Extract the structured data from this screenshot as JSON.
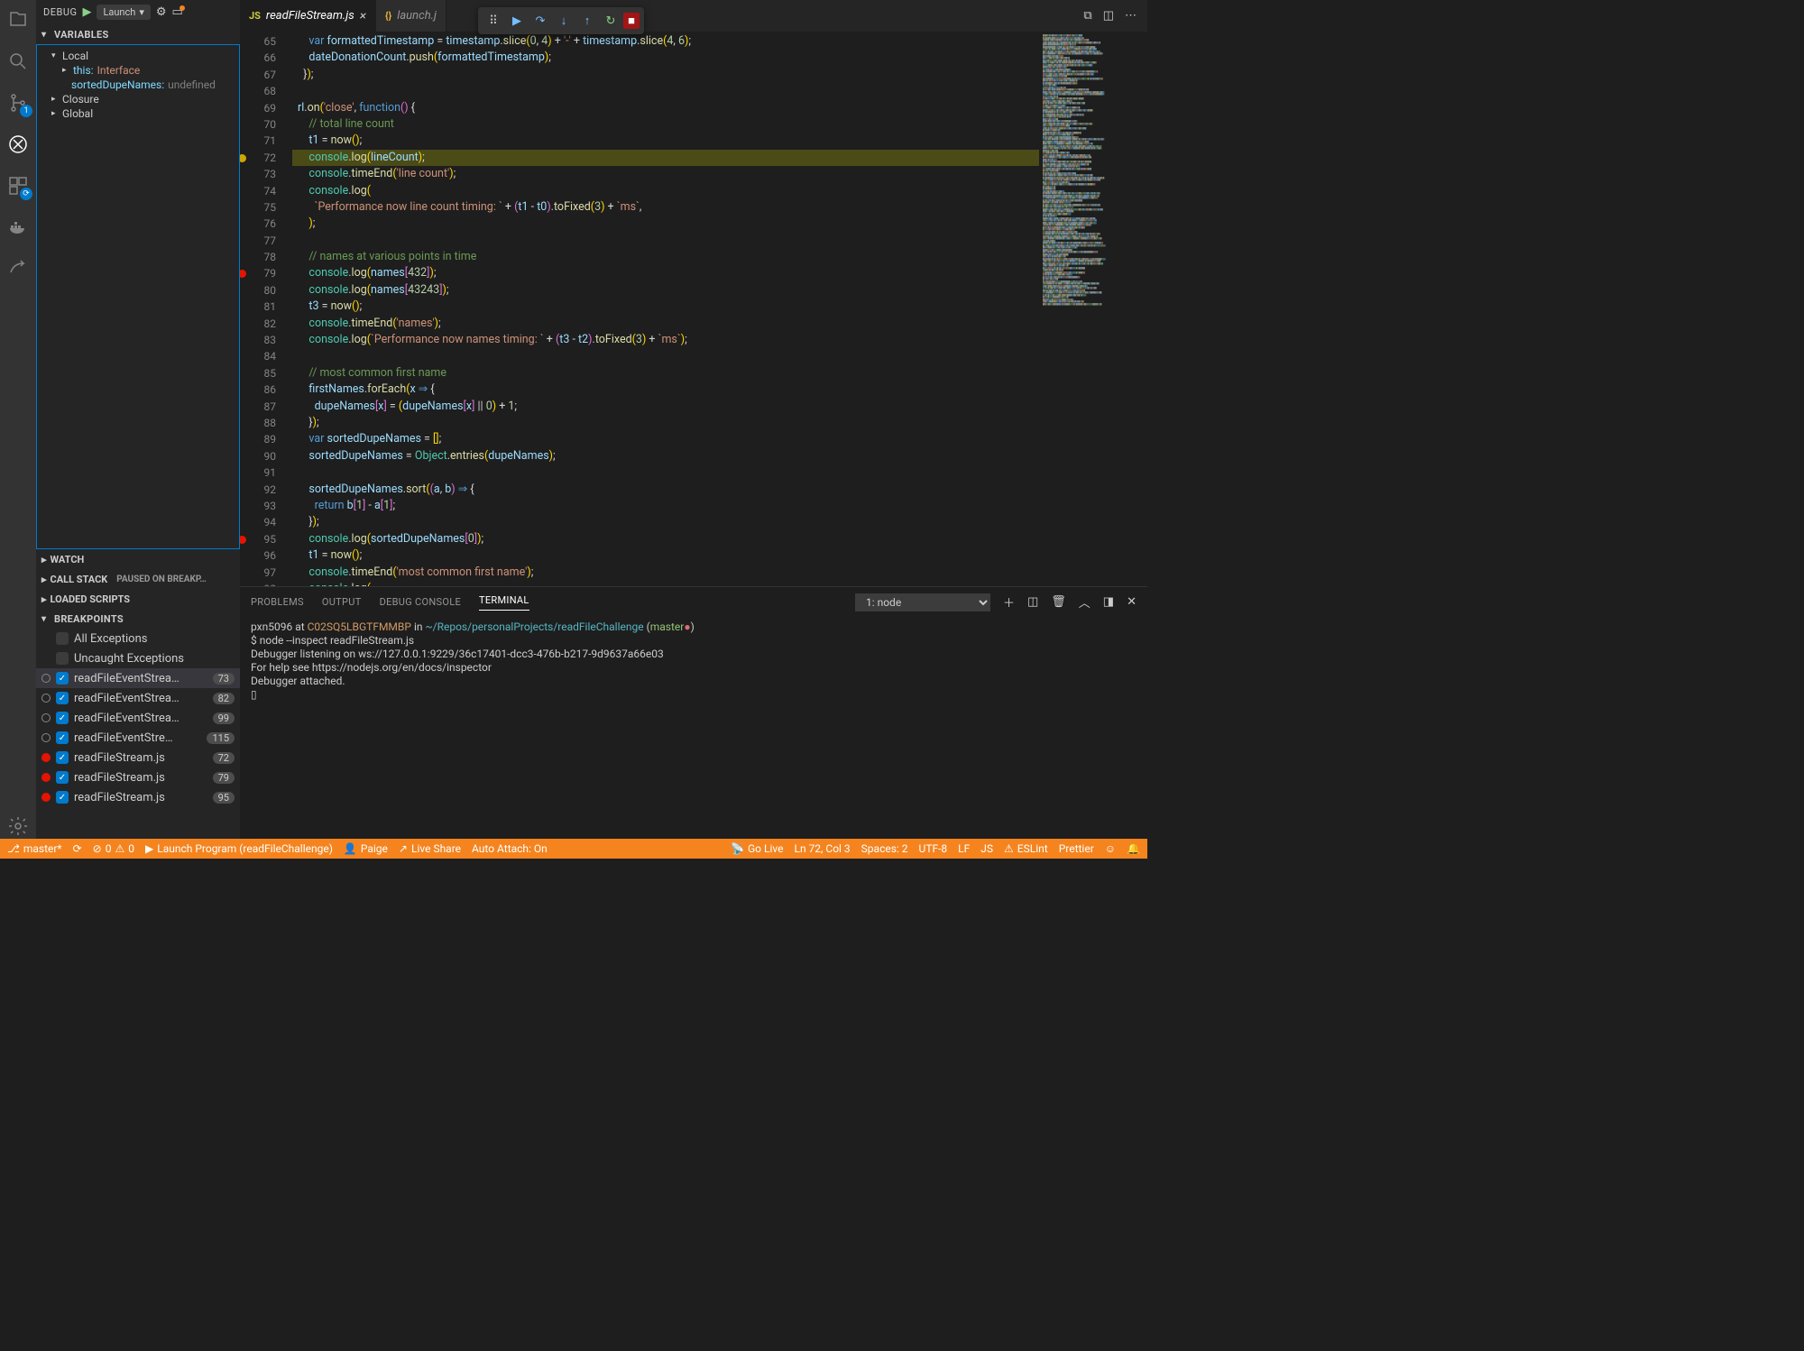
{
  "debugHeader": {
    "label": "DEBUG",
    "launchConfig": "Launch"
  },
  "tabs": [
    {
      "name": "readFileStream.js",
      "active": true,
      "icon": "JS"
    },
    {
      "name": "launch.j",
      "active": false,
      "icon": "{}"
    }
  ],
  "sidebar": {
    "variables": {
      "title": "VARIABLES",
      "scopes": [
        {
          "name": "Local",
          "expanded": true,
          "items": [
            {
              "kind": "ref",
              "label": "this:",
              "value": "Interface"
            },
            {
              "kind": "var",
              "label": "sortedDupeNames:",
              "value": "undefined"
            }
          ]
        },
        {
          "name": "Closure",
          "expanded": false
        },
        {
          "name": "Global",
          "expanded": false
        }
      ]
    },
    "watch": {
      "title": "WATCH"
    },
    "callStack": {
      "title": "CALL STACK",
      "status": "PAUSED ON BREAKP…"
    },
    "loadedScripts": {
      "title": "LOADED SCRIPTS"
    },
    "breakpoints": {
      "title": "BREAKPOINTS",
      "items": [
        {
          "type": "exc",
          "checked": false,
          "label": "All Exceptions"
        },
        {
          "type": "exc",
          "checked": false,
          "label": "Uncaught Exceptions"
        },
        {
          "type": "bp",
          "dot": "hollow",
          "checked": true,
          "label": "readFileEventStrea…",
          "line": "73",
          "sel": true
        },
        {
          "type": "bp",
          "dot": "hollow",
          "checked": true,
          "label": "readFileEventStrea…",
          "line": "82"
        },
        {
          "type": "bp",
          "dot": "hollow",
          "checked": true,
          "label": "readFileEventStrea…",
          "line": "99"
        },
        {
          "type": "bp",
          "dot": "hollow",
          "checked": true,
          "label": "readFileEventStre…",
          "line": "115"
        },
        {
          "type": "bp",
          "dot": "solid",
          "checked": true,
          "label": "readFileStream.js",
          "line": "72"
        },
        {
          "type": "bp",
          "dot": "solid",
          "checked": true,
          "label": "readFileStream.js",
          "line": "79"
        },
        {
          "type": "bp",
          "dot": "solid",
          "checked": true,
          "label": "readFileStream.js",
          "line": "95"
        }
      ]
    }
  },
  "code": {
    "startLine": 65,
    "currentLine": 72,
    "breakpoints": {
      "79": "red",
      "95": "red",
      "72": "yellow"
    },
    "lines": [
      [
        [
          "    ",
          ""
        ],
        [
          "var ",
          "kw"
        ],
        [
          "formattedTimestamp",
          "var"
        ],
        [
          " = ",
          "op"
        ],
        [
          "timestamp",
          "var"
        ],
        [
          ".",
          "op"
        ],
        [
          "slice",
          "fn"
        ],
        [
          "(",
          "par"
        ],
        [
          "0",
          "num"
        ],
        [
          ", ",
          "op"
        ],
        [
          "4",
          "num"
        ],
        [
          ")",
          "par"
        ],
        [
          " + ",
          "op"
        ],
        [
          "'-'",
          "str"
        ],
        [
          " + ",
          "op"
        ],
        [
          "timestamp",
          "var"
        ],
        [
          ".",
          "op"
        ],
        [
          "slice",
          "fn"
        ],
        [
          "(",
          "par"
        ],
        [
          "4",
          "num"
        ],
        [
          ", ",
          "op"
        ],
        [
          "6",
          "num"
        ],
        [
          ")",
          "par"
        ],
        [
          ";",
          "op"
        ]
      ],
      [
        [
          "    ",
          ""
        ],
        [
          "dateDonationCount",
          "var"
        ],
        [
          ".",
          "op"
        ],
        [
          "push",
          "fn"
        ],
        [
          "(",
          "par"
        ],
        [
          "formattedTimestamp",
          "var"
        ],
        [
          ")",
          "par"
        ],
        [
          ";",
          "op"
        ]
      ],
      [
        [
          "  }",
          "pun"
        ],
        [
          ")",
          "par"
        ],
        [
          ";",
          "op"
        ]
      ],
      [
        [
          "",
          ""
        ]
      ],
      [
        [
          "rl",
          "var"
        ],
        [
          ".",
          "op"
        ],
        [
          "on",
          "fn"
        ],
        [
          "(",
          "par"
        ],
        [
          "'close'",
          "str"
        ],
        [
          ", ",
          "op"
        ],
        [
          "function",
          "kw"
        ],
        [
          "()",
          "par2"
        ],
        [
          " {",
          "pun"
        ]
      ],
      [
        [
          "    ",
          ""
        ],
        [
          "// total line count",
          "cmt"
        ]
      ],
      [
        [
          "    ",
          ""
        ],
        [
          "t1",
          "var"
        ],
        [
          " = ",
          "op"
        ],
        [
          "now",
          "fn"
        ],
        [
          "()",
          "par"
        ],
        [
          ";",
          "op"
        ]
      ],
      [
        [
          "    ",
          ""
        ],
        [
          "console",
          "obj"
        ],
        [
          ".",
          "op"
        ],
        [
          "log",
          "fn"
        ],
        [
          "(",
          "par"
        ],
        [
          "lineCount",
          "var"
        ],
        [
          ")",
          "par"
        ],
        [
          ";",
          "op"
        ]
      ],
      [
        [
          "    ",
          ""
        ],
        [
          "console",
          "obj"
        ],
        [
          ".",
          "op"
        ],
        [
          "timeEnd",
          "fn"
        ],
        [
          "(",
          "par"
        ],
        [
          "'line count'",
          "str"
        ],
        [
          ")",
          "par"
        ],
        [
          ";",
          "op"
        ]
      ],
      [
        [
          "    ",
          ""
        ],
        [
          "console",
          "obj"
        ],
        [
          ".",
          "op"
        ],
        [
          "log",
          "fn"
        ],
        [
          "(",
          "par"
        ]
      ],
      [
        [
          "      ",
          ""
        ],
        [
          "`Performance now line count timing: `",
          "str"
        ],
        [
          " + ",
          "op"
        ],
        [
          "(",
          "par2"
        ],
        [
          "t1",
          "var"
        ],
        [
          " - ",
          "op"
        ],
        [
          "t0",
          "var"
        ],
        [
          ")",
          "par2"
        ],
        [
          ".",
          "op"
        ],
        [
          "toFixed",
          "fn"
        ],
        [
          "(",
          "par"
        ],
        [
          "3",
          "num"
        ],
        [
          ")",
          "par"
        ],
        [
          " + ",
          "op"
        ],
        [
          "`ms`",
          "str"
        ],
        [
          ",",
          "op"
        ]
      ],
      [
        [
          "    ",
          ""
        ],
        [
          ")",
          "par"
        ],
        [
          ";",
          "op"
        ]
      ],
      [
        [
          "",
          ""
        ]
      ],
      [
        [
          "    ",
          ""
        ],
        [
          "// names at various points in time",
          "cmt"
        ]
      ],
      [
        [
          "    ",
          ""
        ],
        [
          "console",
          "obj"
        ],
        [
          ".",
          "op"
        ],
        [
          "log",
          "fn"
        ],
        [
          "(",
          "par"
        ],
        [
          "names",
          "var"
        ],
        [
          "[",
          "par2"
        ],
        [
          "432",
          "num"
        ],
        [
          "]",
          "par2"
        ],
        [
          ")",
          "par"
        ],
        [
          ";",
          "op"
        ]
      ],
      [
        [
          "    ",
          ""
        ],
        [
          "console",
          "obj"
        ],
        [
          ".",
          "op"
        ],
        [
          "log",
          "fn"
        ],
        [
          "(",
          "par"
        ],
        [
          "names",
          "var"
        ],
        [
          "[",
          "par2"
        ],
        [
          "43243",
          "num"
        ],
        [
          "]",
          "par2"
        ],
        [
          ")",
          "par"
        ],
        [
          ";",
          "op"
        ]
      ],
      [
        [
          "    ",
          ""
        ],
        [
          "t3",
          "var"
        ],
        [
          " = ",
          "op"
        ],
        [
          "now",
          "fn"
        ],
        [
          "()",
          "par"
        ],
        [
          ";",
          "op"
        ]
      ],
      [
        [
          "    ",
          ""
        ],
        [
          "console",
          "obj"
        ],
        [
          ".",
          "op"
        ],
        [
          "timeEnd",
          "fn"
        ],
        [
          "(",
          "par"
        ],
        [
          "'names'",
          "str"
        ],
        [
          ")",
          "par"
        ],
        [
          ";",
          "op"
        ]
      ],
      [
        [
          "    ",
          ""
        ],
        [
          "console",
          "obj"
        ],
        [
          ".",
          "op"
        ],
        [
          "log",
          "fn"
        ],
        [
          "(",
          "par"
        ],
        [
          "`Performance now names timing: `",
          "str"
        ],
        [
          " + ",
          "op"
        ],
        [
          "(",
          "par2"
        ],
        [
          "t3",
          "var"
        ],
        [
          " - ",
          "op"
        ],
        [
          "t2",
          "var"
        ],
        [
          ")",
          "par2"
        ],
        [
          ".",
          "op"
        ],
        [
          "toFixed",
          "fn"
        ],
        [
          "(",
          "par"
        ],
        [
          "3",
          "num"
        ],
        [
          ")",
          "par"
        ],
        [
          " + ",
          "op"
        ],
        [
          "`ms`",
          "str"
        ],
        [
          ")",
          "par"
        ],
        [
          ";",
          "op"
        ]
      ],
      [
        [
          "",
          ""
        ]
      ],
      [
        [
          "    ",
          ""
        ],
        [
          "// most common first name",
          "cmt"
        ]
      ],
      [
        [
          "    ",
          ""
        ],
        [
          "firstNames",
          "var"
        ],
        [
          ".",
          "op"
        ],
        [
          "forEach",
          "fn"
        ],
        [
          "(",
          "par"
        ],
        [
          "x",
          "var"
        ],
        [
          " ⇒ ",
          "kw"
        ],
        [
          "{",
          "pun"
        ]
      ],
      [
        [
          "      ",
          ""
        ],
        [
          "dupeNames",
          "var"
        ],
        [
          "[",
          "par2"
        ],
        [
          "x",
          "var"
        ],
        [
          "]",
          "par2"
        ],
        [
          " = ",
          "op"
        ],
        [
          "(",
          "par"
        ],
        [
          "dupeNames",
          "var"
        ],
        [
          "[",
          "par2"
        ],
        [
          "x",
          "var"
        ],
        [
          "]",
          "par2"
        ],
        [
          " || ",
          "op"
        ],
        [
          "0",
          "num"
        ],
        [
          ")",
          "par"
        ],
        [
          " + ",
          "op"
        ],
        [
          "1",
          "num"
        ],
        [
          ";",
          "op"
        ]
      ],
      [
        [
          "    }",
          "pun"
        ],
        [
          ")",
          "par"
        ],
        [
          ";",
          "op"
        ]
      ],
      [
        [
          "    ",
          ""
        ],
        [
          "var ",
          "kw"
        ],
        [
          "sortedDupeNames",
          "var"
        ],
        [
          " = ",
          "op"
        ],
        [
          "[]",
          "par"
        ],
        [
          ";",
          "op"
        ]
      ],
      [
        [
          "    ",
          ""
        ],
        [
          "sortedDupeNames",
          "var"
        ],
        [
          " = ",
          "op"
        ],
        [
          "Object",
          "obj"
        ],
        [
          ".",
          "op"
        ],
        [
          "entries",
          "fn"
        ],
        [
          "(",
          "par"
        ],
        [
          "dupeNames",
          "var"
        ],
        [
          ")",
          "par"
        ],
        [
          ";",
          "op"
        ]
      ],
      [
        [
          "",
          ""
        ]
      ],
      [
        [
          "    ",
          ""
        ],
        [
          "sortedDupeNames",
          "var"
        ],
        [
          ".",
          "op"
        ],
        [
          "sort",
          "fn"
        ],
        [
          "(",
          "par"
        ],
        [
          "(",
          "par2"
        ],
        [
          "a",
          "var"
        ],
        [
          ", ",
          "op"
        ],
        [
          "b",
          "var"
        ],
        [
          ")",
          "par2"
        ],
        [
          " ⇒ ",
          "kw"
        ],
        [
          "{",
          "pun"
        ]
      ],
      [
        [
          "      ",
          ""
        ],
        [
          "return ",
          "kw"
        ],
        [
          "b",
          "var"
        ],
        [
          "[",
          "par2"
        ],
        [
          "1",
          "num"
        ],
        [
          "]",
          "par2"
        ],
        [
          " - ",
          "op"
        ],
        [
          "a",
          "var"
        ],
        [
          "[",
          "par2"
        ],
        [
          "1",
          "num"
        ],
        [
          "]",
          "par2"
        ],
        [
          ";",
          "op"
        ]
      ],
      [
        [
          "    }",
          "pun"
        ],
        [
          ")",
          "par"
        ],
        [
          ";",
          "op"
        ]
      ],
      [
        [
          "    ",
          ""
        ],
        [
          "console",
          "obj"
        ],
        [
          ".",
          "op"
        ],
        [
          "log",
          "fn"
        ],
        [
          "(",
          "par"
        ],
        [
          "sortedDupeNames",
          "var"
        ],
        [
          "[",
          "par2"
        ],
        [
          "0",
          "num"
        ],
        [
          "]",
          "par2"
        ],
        [
          ")",
          "par"
        ],
        [
          ";",
          "op"
        ]
      ],
      [
        [
          "    ",
          ""
        ],
        [
          "t1",
          "var"
        ],
        [
          " = ",
          "op"
        ],
        [
          "now",
          "fn"
        ],
        [
          "()",
          "par"
        ],
        [
          ";",
          "op"
        ]
      ],
      [
        [
          "    ",
          ""
        ],
        [
          "console",
          "obj"
        ],
        [
          ".",
          "op"
        ],
        [
          "timeEnd",
          "fn"
        ],
        [
          "(",
          "par"
        ],
        [
          "'most common first name'",
          "str"
        ],
        [
          ")",
          "par"
        ],
        [
          ";",
          "op"
        ]
      ],
      [
        [
          "    ",
          ""
        ],
        [
          "console",
          "obj"
        ],
        [
          ".",
          "op"
        ],
        [
          "log",
          "fn"
        ],
        [
          "(",
          "par"
        ]
      ]
    ]
  },
  "panel": {
    "tabs": [
      "PROBLEMS",
      "OUTPUT",
      "DEBUG CONSOLE",
      "TERMINAL"
    ],
    "activeTab": 3,
    "terminalSelect": "1: node",
    "terminal": [
      [
        [
          "pxn5096",
          "user"
        ],
        [
          " at ",
          "op"
        ],
        [
          "C02SQ5LBGTFMMBP",
          "host"
        ],
        [
          " in ",
          "op"
        ],
        [
          "~/Repos/personalProjects/readFileChallenge",
          "path"
        ],
        [
          " (",
          "op"
        ],
        [
          "master",
          "branch"
        ],
        [
          "●",
          "dot"
        ],
        [
          ")",
          "op"
        ]
      ],
      [
        [
          "$ node --inspect readFileStream.js",
          "op"
        ]
      ],
      [
        [
          "Debugger listening on ws://127.0.0.1:9229/36c17401-dcc3-476b-b217-9d9637a66e03",
          "op"
        ]
      ],
      [
        [
          "For help see https://nodejs.org/en/docs/inspector",
          "op"
        ]
      ],
      [
        [
          "Debugger attached.",
          "op"
        ]
      ],
      [
        [
          "▯",
          "op"
        ]
      ]
    ]
  },
  "status": {
    "branch": "master*",
    "errors": "0",
    "warnings": "0",
    "launch": "Launch Program (readFileChallenge)",
    "user": "Paige",
    "liveShare": "Live Share",
    "autoAttach": "Auto Attach: On",
    "goLive": "Go Live",
    "pos": "Ln 72, Col 3",
    "spaces": "Spaces: 2",
    "encoding": "UTF-8",
    "eol": "LF",
    "lang": "JS",
    "eslint": "ESLint",
    "prettier": "Prettier"
  }
}
